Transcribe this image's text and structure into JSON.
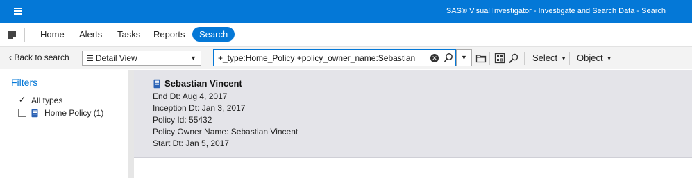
{
  "app": {
    "title": "SAS® Visual Investigator - Investigate and Search Data - Search"
  },
  "nav": {
    "tabs": [
      {
        "label": "Home"
      },
      {
        "label": "Alerts"
      },
      {
        "label": "Tasks"
      },
      {
        "label": "Reports"
      },
      {
        "label": "Search",
        "active": true
      }
    ]
  },
  "toolbar": {
    "back_label": "Back to search",
    "view_select": "Detail View",
    "search_query": "+_type:Home_Policy +policy_owner_name:Sebastian",
    "select_label": "Select",
    "object_label": "Object"
  },
  "filters": {
    "heading": "Filters",
    "items": [
      {
        "label": "All types",
        "checked": true
      },
      {
        "label": "Home Policy (1)",
        "checked": false,
        "icon": "book-icon"
      }
    ]
  },
  "result": {
    "name": "Sebastian Vincent",
    "fields": [
      "End Dt: Aug 4, 2017",
      "Inception Dt: Jan 3, 2017",
      "Policy Id: 55432",
      "Policy Owner Name: Sebastian Vincent",
      "Start Dt: Jan 5, 2017"
    ]
  },
  "colors": {
    "brand": "#0478d7",
    "card_bg": "#e4e4e9",
    "toolbar_bg": "#f3f3f3"
  }
}
